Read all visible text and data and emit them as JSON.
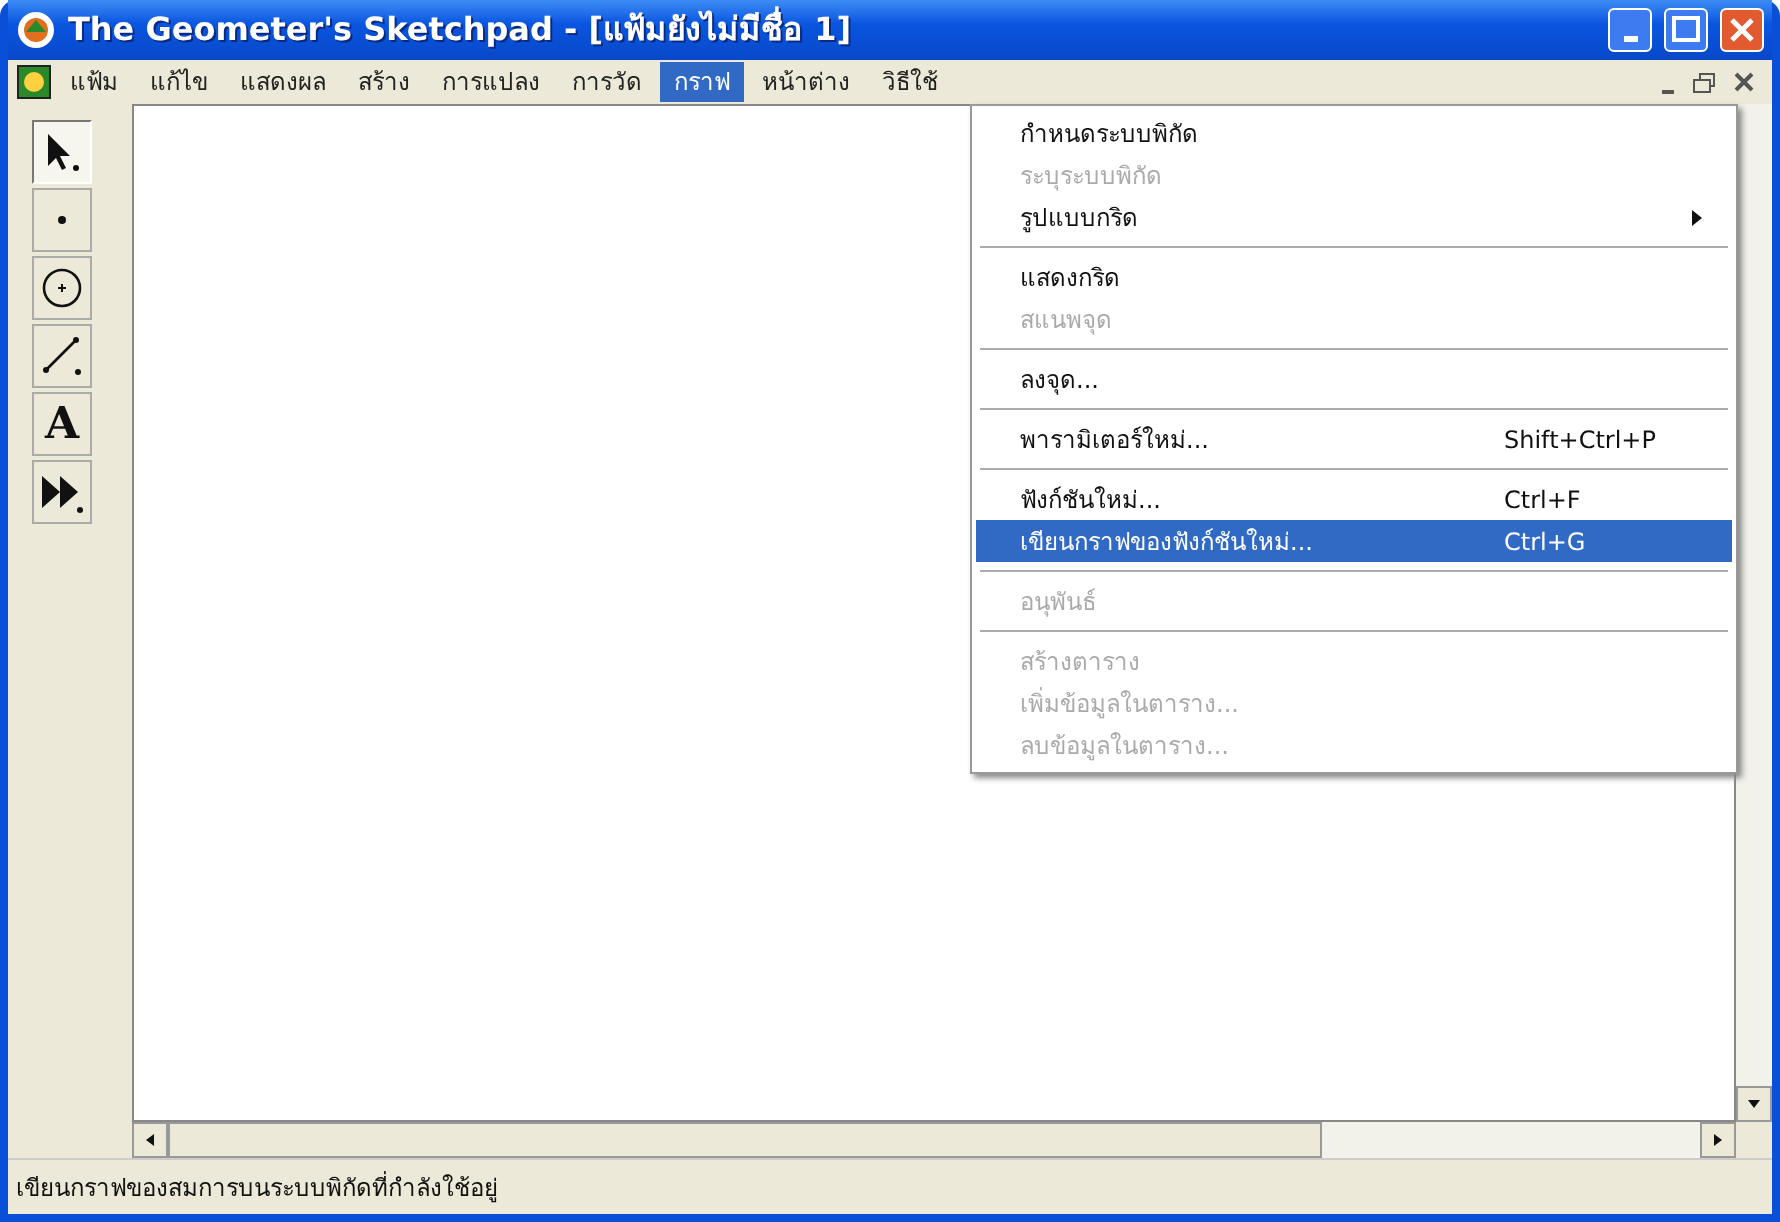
{
  "window": {
    "title": "The Geometer's Sketchpad - [แฟ้มยังไม่มีชื่อ 1]"
  },
  "menubar": [
    {
      "label": "แฟ้ม",
      "selected": false
    },
    {
      "label": "แก้ไข",
      "selected": false
    },
    {
      "label": "แสดงผล",
      "selected": false
    },
    {
      "label": "สร้าง",
      "selected": false
    },
    {
      "label": "การแปลง",
      "selected": false
    },
    {
      "label": "การวัด",
      "selected": false
    },
    {
      "label": "กราฟ",
      "selected": true
    },
    {
      "label": "หน้าต่าง",
      "selected": false
    },
    {
      "label": "วิธีใช้",
      "selected": false
    }
  ],
  "tools": [
    {
      "kind": "arrow",
      "selected": true
    },
    {
      "kind": "point",
      "selected": false
    },
    {
      "kind": "compass",
      "selected": false
    },
    {
      "kind": "line",
      "selected": false
    },
    {
      "kind": "text",
      "label": "A",
      "selected": false
    },
    {
      "kind": "custom",
      "selected": false
    }
  ],
  "menu": [
    {
      "kind": "item",
      "label": "กำหนดระบบพิกัด",
      "disabled": false,
      "selected": false
    },
    {
      "kind": "item",
      "label": "ระบุระบบพิกัด",
      "disabled": true,
      "selected": false
    },
    {
      "kind": "item",
      "label": "รูปแบบกริด",
      "disabled": false,
      "selected": false,
      "submenu": true
    },
    {
      "kind": "separator"
    },
    {
      "kind": "item",
      "label": "แสดงกริด",
      "disabled": false,
      "selected": false
    },
    {
      "kind": "item",
      "label": "สแนพจุด",
      "disabled": true,
      "selected": false
    },
    {
      "kind": "separator"
    },
    {
      "kind": "item",
      "label": "ลงจุด...",
      "disabled": false,
      "selected": false
    },
    {
      "kind": "separator"
    },
    {
      "kind": "item",
      "label": "พารามิเตอร์ใหม่...",
      "shortcut": "Shift+Ctrl+P",
      "disabled": false,
      "selected": false
    },
    {
      "kind": "separator"
    },
    {
      "kind": "item",
      "label": "ฟังก์ชันใหม่...",
      "shortcut": "Ctrl+F",
      "disabled": false,
      "selected": false
    },
    {
      "kind": "item",
      "label": "เขียนกราฟของฟังก์ชันใหม่...",
      "shortcut": "Ctrl+G",
      "disabled": false,
      "selected": true
    },
    {
      "kind": "separator"
    },
    {
      "kind": "item",
      "label": "อนุพันธ์",
      "disabled": true,
      "selected": false
    },
    {
      "kind": "separator"
    },
    {
      "kind": "item",
      "label": "สร้างตาราง",
      "disabled": true,
      "selected": false
    },
    {
      "kind": "item",
      "label": "เพิ่มข้อมูลในตาราง...",
      "disabled": true,
      "selected": false
    },
    {
      "kind": "item",
      "label": "ลบข้อมูลในตาราง...",
      "disabled": true,
      "selected": false
    }
  ],
  "status_bar": "เขียนกราฟของสมการบนระบบพิกัดที่กำลังใช้อยู่"
}
